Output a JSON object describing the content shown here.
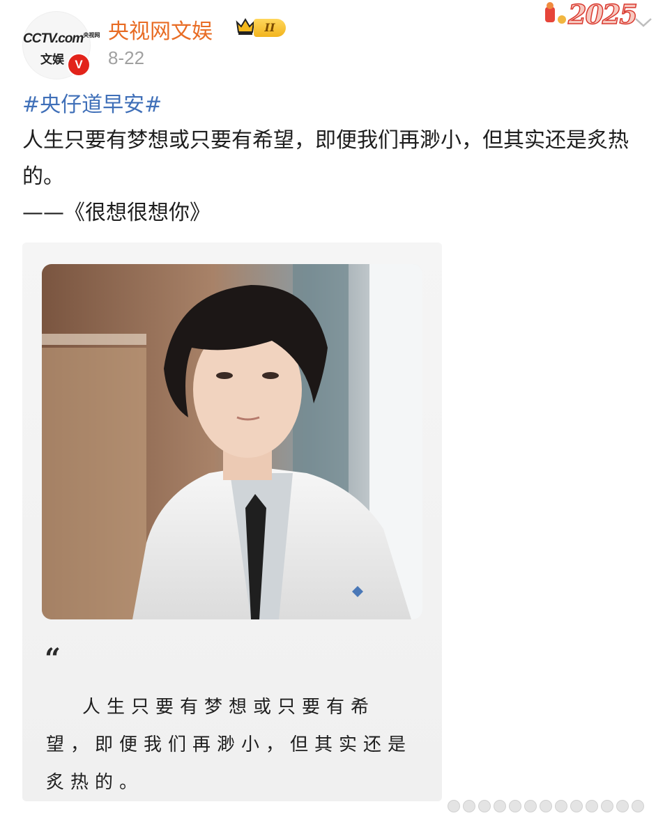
{
  "post": {
    "author": {
      "name": "央视网文娱",
      "avatar_text_top": "CCTV",
      "avatar_text_com": ".com",
      "avatar_text_sub": "央视网",
      "avatar_text_bottom": "文娱",
      "verified_badge": "V",
      "level_badge": "II",
      "level_icon": "crown-icon"
    },
    "date": "8-22",
    "header_decoration": "2025",
    "hashtag": "#央仔道早安#",
    "body_text": "人生只要有梦想或只要有希望，即便我们再渺小，但其实还是炙热的。",
    "source": "——《很想很想你》",
    "card": {
      "quote_mark": "“",
      "quote_text": "人生只要有梦想或只要有希望，即便我们再渺小，但其实还是炙热的。"
    }
  },
  "colors": {
    "author_name": "#e86c24",
    "hashtag": "#3f6fb8",
    "verified": "#e2231a",
    "date": "#a0a0a0"
  }
}
